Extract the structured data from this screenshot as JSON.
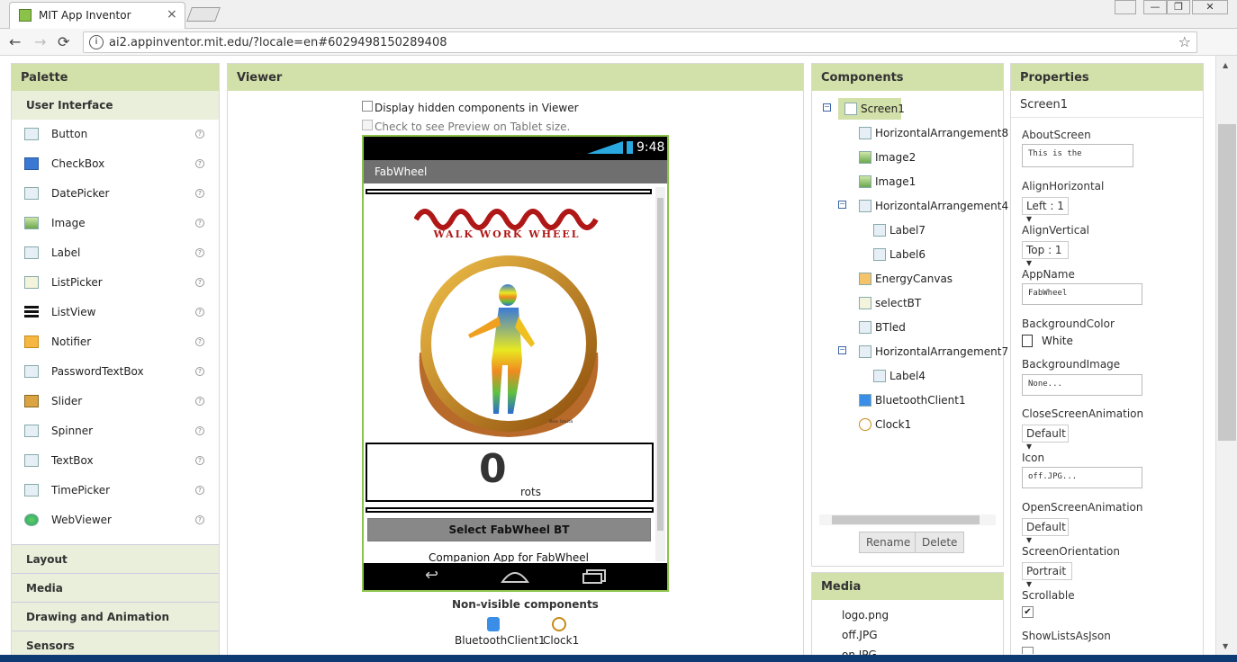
{
  "browser": {
    "tab_title": "MIT App Inventor",
    "tab_close": "×",
    "url": "ai2.appinventor.mit.edu/?locale=en#6029498150289408",
    "back": "←",
    "forward": "→",
    "reload": "⟳",
    "star": "☆",
    "menu": "⋮",
    "win_min": "—",
    "win_max": "❐",
    "win_close": "✕",
    "user": "👤"
  },
  "palette": {
    "title": "Palette",
    "active_category": "User Interface",
    "items": [
      "Button",
      "CheckBox",
      "DatePicker",
      "Image",
      "Label",
      "ListPicker",
      "ListView",
      "Notifier",
      "PasswordTextBox",
      "Slider",
      "Spinner",
      "TextBox",
      "TimePicker",
      "WebViewer"
    ],
    "help": "?",
    "categories": [
      "Layout",
      "Media",
      "Drawing and Animation",
      "Sensors"
    ]
  },
  "viewer": {
    "title": "Viewer",
    "hidden_label": "Display hidden components in Viewer",
    "tablet_label": "Check to see Preview on Tablet size.",
    "phone": {
      "time": "9:48",
      "app_title": "FabWheel",
      "logo_text": "WALK WORK WHEEL",
      "counter": "0",
      "counter_unit": "rots",
      "select_button": "Select FabWheel BT",
      "companion_text": "Companion App for FabWheel",
      "small_credit": "Ben Smith\nFabLab Yokosuka"
    },
    "nonvisible_title": "Non-visible components",
    "nonvisible": [
      "BluetoothClient1",
      "Clock1"
    ]
  },
  "components": {
    "title": "Components",
    "tree": [
      {
        "label": "Screen1",
        "level": 0,
        "toggle": "⊟",
        "selected": true
      },
      {
        "label": "HorizontalArrangement8",
        "level": 1
      },
      {
        "label": "Image2",
        "level": 1
      },
      {
        "label": "Image1",
        "level": 1
      },
      {
        "label": "HorizontalArrangement4",
        "level": 1,
        "toggle": "⊟"
      },
      {
        "label": "Label7",
        "level": 2
      },
      {
        "label": "Label6",
        "level": 2
      },
      {
        "label": "EnergyCanvas",
        "level": 1
      },
      {
        "label": "selectBT",
        "level": 1
      },
      {
        "label": "BTled",
        "level": 1
      },
      {
        "label": "HorizontalArrangement7",
        "level": 1,
        "toggle": "⊟"
      },
      {
        "label": "Label4",
        "level": 2
      },
      {
        "label": "BluetoothClient1",
        "level": 1
      },
      {
        "label": "Clock1",
        "level": 1
      }
    ],
    "rename": "Rename",
    "delete": "Delete"
  },
  "media": {
    "title": "Media",
    "files": [
      "logo.png",
      "off.JPG",
      "on.JPG"
    ]
  },
  "properties": {
    "title": "Properties",
    "component": "Screen1",
    "about_label": "AboutScreen",
    "about_value": "This is the",
    "alignh_label": "AlignHorizontal",
    "alignh_value": "Left : 1",
    "alignv_label": "AlignVertical",
    "alignv_value": "Top : 1",
    "appname_label": "AppName",
    "appname_value": "FabWheel",
    "bgcolor_label": "BackgroundColor",
    "bgcolor_value": "White",
    "bgimage_label": "BackgroundImage",
    "bgimage_value": "None...",
    "closeanim_label": "CloseScreenAnimation",
    "closeanim_value": "Default",
    "icon_label": "Icon",
    "icon_value": "off.JPG...",
    "openanim_label": "OpenScreenAnimation",
    "openanim_value": "Default",
    "orient_label": "ScreenOrientation",
    "orient_value": "Portrait",
    "scroll_label": "Scrollable",
    "scroll_checked": "✔",
    "showlists_label": "ShowListsAsJson"
  },
  "colors": {
    "panel_header": "#d2e0a9",
    "phone_border": "#8bc34a",
    "logo_red": "#b01818"
  }
}
